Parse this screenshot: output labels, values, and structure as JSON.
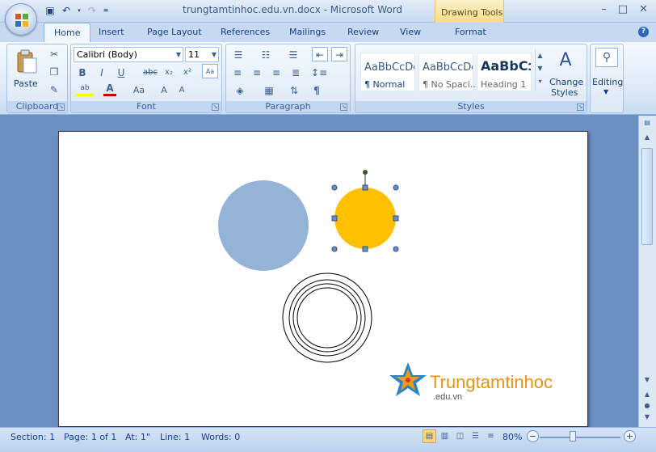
{
  "window": {
    "title": "trungtamtinhoc.edu.vn.docx - Microsoft Word",
    "contextual_tab_group": "Drawing Tools"
  },
  "tabs": [
    {
      "label": "Home"
    },
    {
      "label": "Insert"
    },
    {
      "label": "Page Layout"
    },
    {
      "label": "References"
    },
    {
      "label": "Mailings"
    },
    {
      "label": "Review"
    },
    {
      "label": "View"
    },
    {
      "label": "Format"
    }
  ],
  "ribbon": {
    "clipboard": {
      "paste_label": "Paste",
      "group_label": "Clipboard"
    },
    "font": {
      "font_name": "Calibri (Body)",
      "font_size": "11",
      "group_label": "Font"
    },
    "paragraph": {
      "group_label": "Paragraph"
    },
    "styles": {
      "group_label": "Styles",
      "items": [
        {
          "sample": "AaBbCcDc",
          "name": "¶ Normal"
        },
        {
          "sample": "AaBbCcDc",
          "name": "¶ No Spaci..."
        },
        {
          "sample": "AaBbCɔ",
          "name": "Heading 1"
        }
      ],
      "change_styles_line1": "Change",
      "change_styles_line2": "Styles"
    },
    "editing": {
      "label": "Editing"
    }
  },
  "document": {
    "shapes": [
      {
        "name": "blue-circle",
        "color": "#95b3d7"
      },
      {
        "name": "orange-circle",
        "color": "#ffc000",
        "selected": true
      },
      {
        "name": "concentric-rings",
        "ring_count": 4
      }
    ],
    "watermark": {
      "brand": "Trungtamtinhoc",
      "suffix": ".edu.vn"
    }
  },
  "statusbar": {
    "section": "Section: 1",
    "page": "Page: 1 of 1",
    "at": "At: 1\"",
    "line": "Line: 1",
    "words": "Words: 0",
    "zoom": "80%"
  },
  "colors": {
    "accent": "#15428b",
    "ribbon_bg": "#dbe8f7",
    "doc_bg": "#6b8fc0",
    "contextual_tab": "#f8dc8c"
  }
}
